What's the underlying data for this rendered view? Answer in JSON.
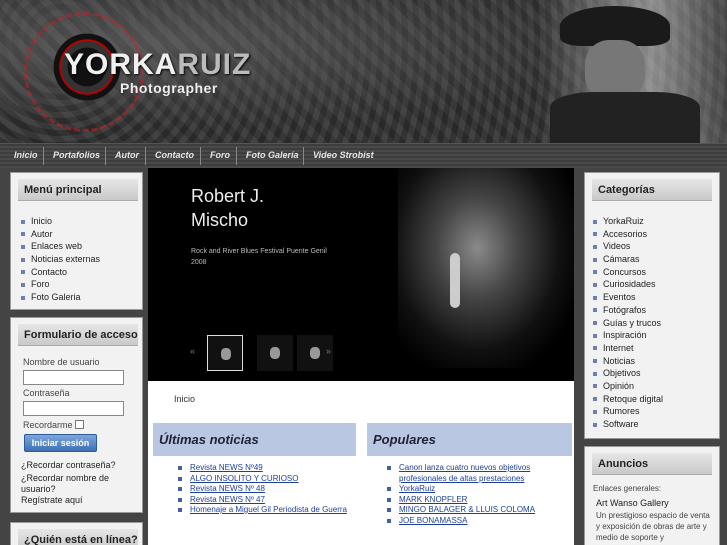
{
  "header": {
    "logo_text_a": "YORKA",
    "logo_text_b": "RUIZ",
    "logo_subtitle": "Photographer"
  },
  "nav": {
    "items": [
      "Inicio",
      "Portafolios",
      "Autor",
      "Contacto",
      "Foro",
      "Foto Galería",
      "Video Strobist"
    ]
  },
  "main_menu": {
    "title": "Menú principal",
    "items": [
      "Inicio",
      "Autor",
      "Enlaces web",
      "Noticias externas",
      "Contacto",
      "Foro",
      "Foto Galeria"
    ]
  },
  "login": {
    "title": "Formulario de acceso",
    "username_label": "Nombre de usuario",
    "password_label": "Contraseña",
    "remember_label": "Recordarme",
    "submit_label": "Iniciar sesión",
    "forgot_password": "¿Recordar contraseña?",
    "forgot_username": "¿Recordar nombre de usuario?",
    "register": "Regístrate aquí"
  },
  "online": {
    "title": "¿Quién está en línea?"
  },
  "slideshow": {
    "title": "Robert J. Mischo",
    "caption": "Rock and River Blues Festival Puente Genil 2008",
    "prev": "«",
    "next": "»"
  },
  "breadcrumb": "Inicio",
  "latest_news": {
    "title": "Últimas noticias",
    "items": [
      "Revista NEWS Nº49",
      "ALGO INSOLITO Y CURIOSO",
      "Revista NEWS Nº 48",
      "Revista NEWS Nº 47",
      "Homenaje a Miguel Gil Periodista de Guerra"
    ]
  },
  "popular": {
    "title": "Populares",
    "items": [
      "Canon lanza cuatro nuevos objetivos profesionales de altas prestaciones",
      "YorkaRuiz",
      "MARK KNOPFLER",
      "MINGO BALAGER & LLUIS COLOMA",
      "JOE BONAMASSA"
    ]
  },
  "categories": {
    "title": "Categorías",
    "items": [
      "YorkaRuiz",
      "Accesorios",
      "Videos",
      "Cámaras",
      "Concursos",
      "Curiosidades",
      "Eventos",
      "Fotógrafos",
      "Guías y trucos",
      "Inspiración",
      "Internet",
      "Noticias",
      "Objetivos",
      "Opinión",
      "Retoque digital",
      "Rumores",
      "Software"
    ]
  },
  "ads": {
    "title": "Anuncios",
    "section_label": "Enlaces generales:",
    "item_title": "Art Wanso Gallery",
    "item_desc": "Un prestigioso espacio de venta y exposición de obras de arte y medio de soporte y"
  },
  "colors": {
    "accent_blue": "#b9c7e3",
    "button_blue": "#3e6fb4",
    "link_blue": "#1d3f9a"
  }
}
